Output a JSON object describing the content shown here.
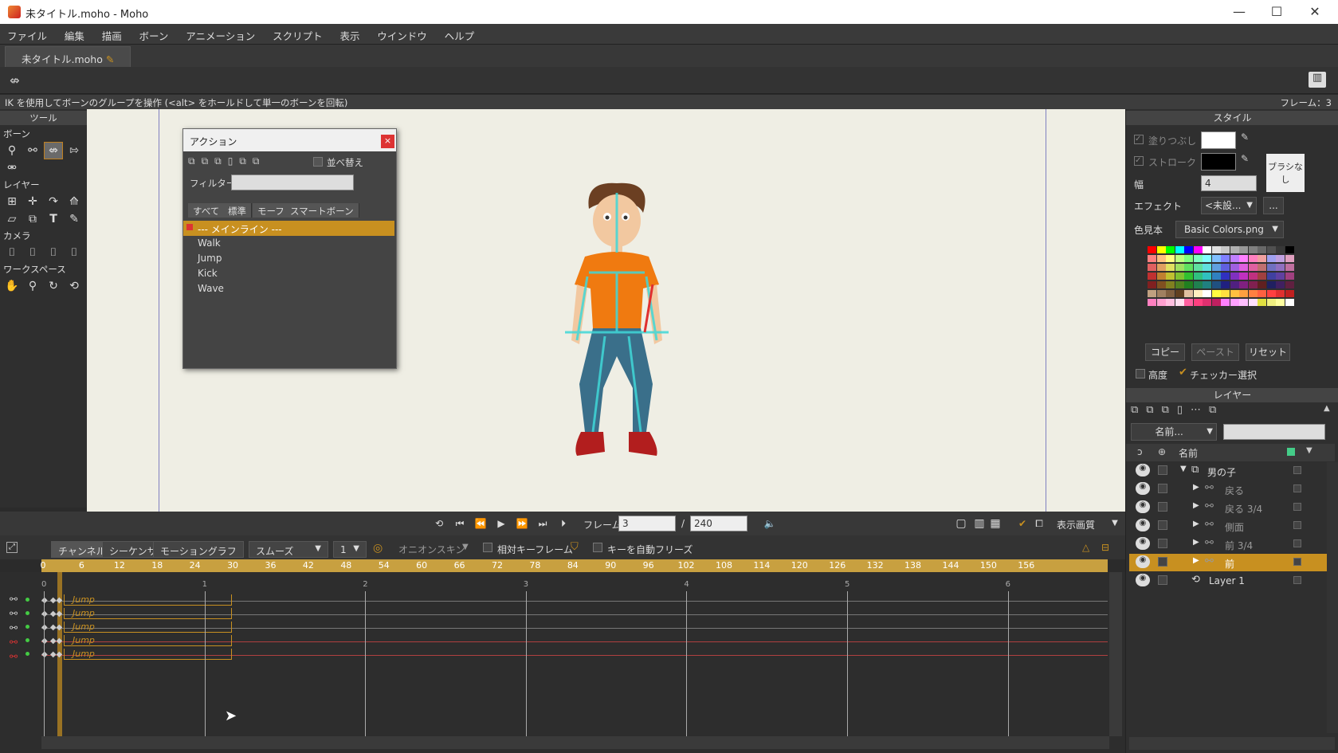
{
  "window": {
    "title": "未タイトル.moho - Moho",
    "minimize": "—",
    "maximize": "☐",
    "close": "✕"
  },
  "menu": [
    "ファイル",
    "編集",
    "描画",
    "ボーン",
    "アニメーション",
    "スクリプト",
    "表示",
    "ウインドウ",
    "ヘルプ"
  ],
  "doc_tab": "未タイトル.moho",
  "status": {
    "message": "IK を使用してボーンのグループを操作 (<alt> をホールドして単一のボーンを回転)",
    "frame_label": "フレーム：3"
  },
  "tools": {
    "title": "ツール",
    "sections": {
      "bone": "ボーン",
      "layer": "レイヤー",
      "camera": "カメラ",
      "workspace": "ワークスペース"
    }
  },
  "action": {
    "title": "アクション",
    "close": "×",
    "sort": "並べ替え",
    "filter_label": "フィルター:",
    "tabs": [
      "すべて",
      "標準",
      "モーフ",
      "スマートボーン"
    ],
    "items": [
      "--- メインライン ---",
      "Walk",
      "Jump",
      "Kick",
      "Wave"
    ],
    "selected": 0
  },
  "playback": {
    "frame_label": "フレーム",
    "current_frame": "3",
    "separator": "/",
    "total_frames": "240",
    "quality": "表示画質"
  },
  "timeline_opts": {
    "tabs": [
      "チャンネル",
      "シーケンサ",
      "モーショングラフ"
    ],
    "interp": "スムーズ",
    "interp_num": "1",
    "onion": "オニオンスキン",
    "relative_keys": "相対キーフレーム",
    "auto_freeze": "キーを自動フリーズ"
  },
  "ruler": [
    "0",
    "6",
    "12",
    "18",
    "24",
    "30",
    "36",
    "42",
    "48",
    "54",
    "60",
    "66",
    "72",
    "78",
    "84",
    "90",
    "96",
    "102",
    "108",
    "114",
    "120",
    "126",
    "132",
    "138",
    "144",
    "150",
    "156"
  ],
  "seconds": [
    "0",
    "1",
    "2",
    "3",
    "4",
    "5",
    "6"
  ],
  "tracks": [
    "Jump",
    "Jump",
    "Jump",
    "Jump",
    "Jump"
  ],
  "style": {
    "title": "スタイル",
    "fill": "塗りつぶし",
    "stroke": "ストローク",
    "width_label": "幅",
    "width_value": "4",
    "brush": "ブラシなし",
    "effect_label": "エフェクト",
    "effect_value": "<未設...",
    "effect_more": "...",
    "palette_label": "色見本",
    "palette_value": "Basic Colors.png",
    "copy": "コピー",
    "paste": "ペースト",
    "reset": "リセット",
    "advanced": "高度",
    "checker": "チェッカー選択"
  },
  "layers": {
    "title": "レイヤー",
    "name_filter": "名前...",
    "col_name": "名前",
    "items": [
      {
        "name": "男の子",
        "indent": 0,
        "expanded": true,
        "selected": false
      },
      {
        "name": "戻る",
        "indent": 1,
        "expanded": false,
        "selected": false
      },
      {
        "name": "戻る 3/4",
        "indent": 1,
        "expanded": false,
        "selected": false
      },
      {
        "name": "側面",
        "indent": 1,
        "expanded": false,
        "selected": false
      },
      {
        "name": "前 3/4",
        "indent": 1,
        "expanded": false,
        "selected": false
      },
      {
        "name": "前",
        "indent": 1,
        "expanded": false,
        "selected": true
      },
      {
        "name": "Layer 1",
        "indent": 0,
        "expanded": false,
        "selected": false
      }
    ]
  },
  "colors": {
    "accent": "#c89020",
    "canvas": "#efeee4",
    "close": "#dd3333"
  }
}
